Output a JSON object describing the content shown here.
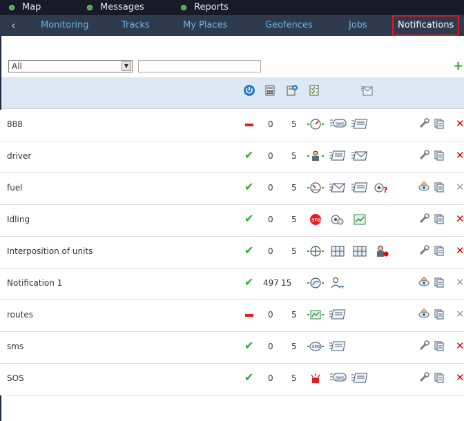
{
  "topnav": {
    "items": [
      {
        "label": "Map"
      },
      {
        "label": "Messages"
      },
      {
        "label": "Reports"
      }
    ]
  },
  "tabs": {
    "items": [
      {
        "label": "Monitoring"
      },
      {
        "label": "Tracks"
      },
      {
        "label": "My Places"
      },
      {
        "label": "Geofences"
      },
      {
        "label": "Jobs"
      },
      {
        "label": "Notifications"
      }
    ],
    "active": "Notifications"
  },
  "filter": {
    "select_value": "All",
    "search_placeholder": ""
  },
  "rows": [
    {
      "name": "888",
      "status": "inactive",
      "c1": "0",
      "c2": "5",
      "icons": [
        "trigger-speed-icon",
        "sms-icon",
        "notify-window-icon"
      ],
      "actions": [
        "edit",
        "copy",
        "delete"
      ]
    },
    {
      "name": "driver",
      "status": "active",
      "c1": "0",
      "c2": "5",
      "icons": [
        "trigger-driver-icon",
        "notify-window-icon",
        "email-icon"
      ],
      "actions": [
        "edit",
        "copy",
        "delete"
      ]
    },
    {
      "name": "fuel",
      "status": "active",
      "c1": "0",
      "c2": "5",
      "icons": [
        "trigger-fuel-icon",
        "email-icon",
        "notify-window-icon",
        "unknown-sensor-icon"
      ],
      "actions": [
        "view",
        "copy",
        "delete-disabled"
      ]
    },
    {
      "name": "Idling",
      "status": "active",
      "c1": "0",
      "c2": "5",
      "icons": [
        "stop-icon",
        "sensor-icon",
        "chart-icon"
      ],
      "actions": [
        "edit",
        "copy",
        "delete"
      ]
    },
    {
      "name": "Interposition of units",
      "status": "active",
      "c1": "0",
      "c2": "5",
      "icons": [
        "trigger-interposition-icon",
        "grid-icon",
        "grid-icon",
        "driver-icon"
      ],
      "actions": [
        "edit",
        "copy",
        "delete"
      ]
    },
    {
      "name": "Notification 1",
      "status": "active",
      "c1": "497",
      "c2": "15",
      "icons": [
        "trigger-connection-icon",
        "user-key-icon"
      ],
      "actions": [
        "view",
        "copy",
        "delete-disabled"
      ]
    },
    {
      "name": "routes",
      "status": "inactive",
      "c1": "0",
      "c2": "5",
      "icons": [
        "trigger-route-icon",
        "notify-window-icon"
      ],
      "actions": [
        "view",
        "copy",
        "delete-disabled"
      ]
    },
    {
      "name": "sms",
      "status": "active",
      "c1": "0",
      "c2": "5",
      "icons": [
        "trigger-sms-icon",
        "notify-window-icon"
      ],
      "actions": [
        "edit",
        "copy",
        "delete"
      ]
    },
    {
      "name": "SOS",
      "status": "active",
      "c1": "0",
      "c2": "5",
      "icons": [
        "alarm-icon",
        "sms-icon",
        "notify-window-icon"
      ],
      "actions": [
        "edit",
        "copy",
        "delete"
      ]
    }
  ],
  "colors": {
    "topnav_bg": "#181a2a",
    "tabbar_bg": "#2e3a4e",
    "tab_text": "#6ab6e8",
    "active_outline": "#d91a1a",
    "header_bg": "#dce8f3",
    "ok_green": "#2aa82a",
    "danger_red": "#e02020"
  }
}
